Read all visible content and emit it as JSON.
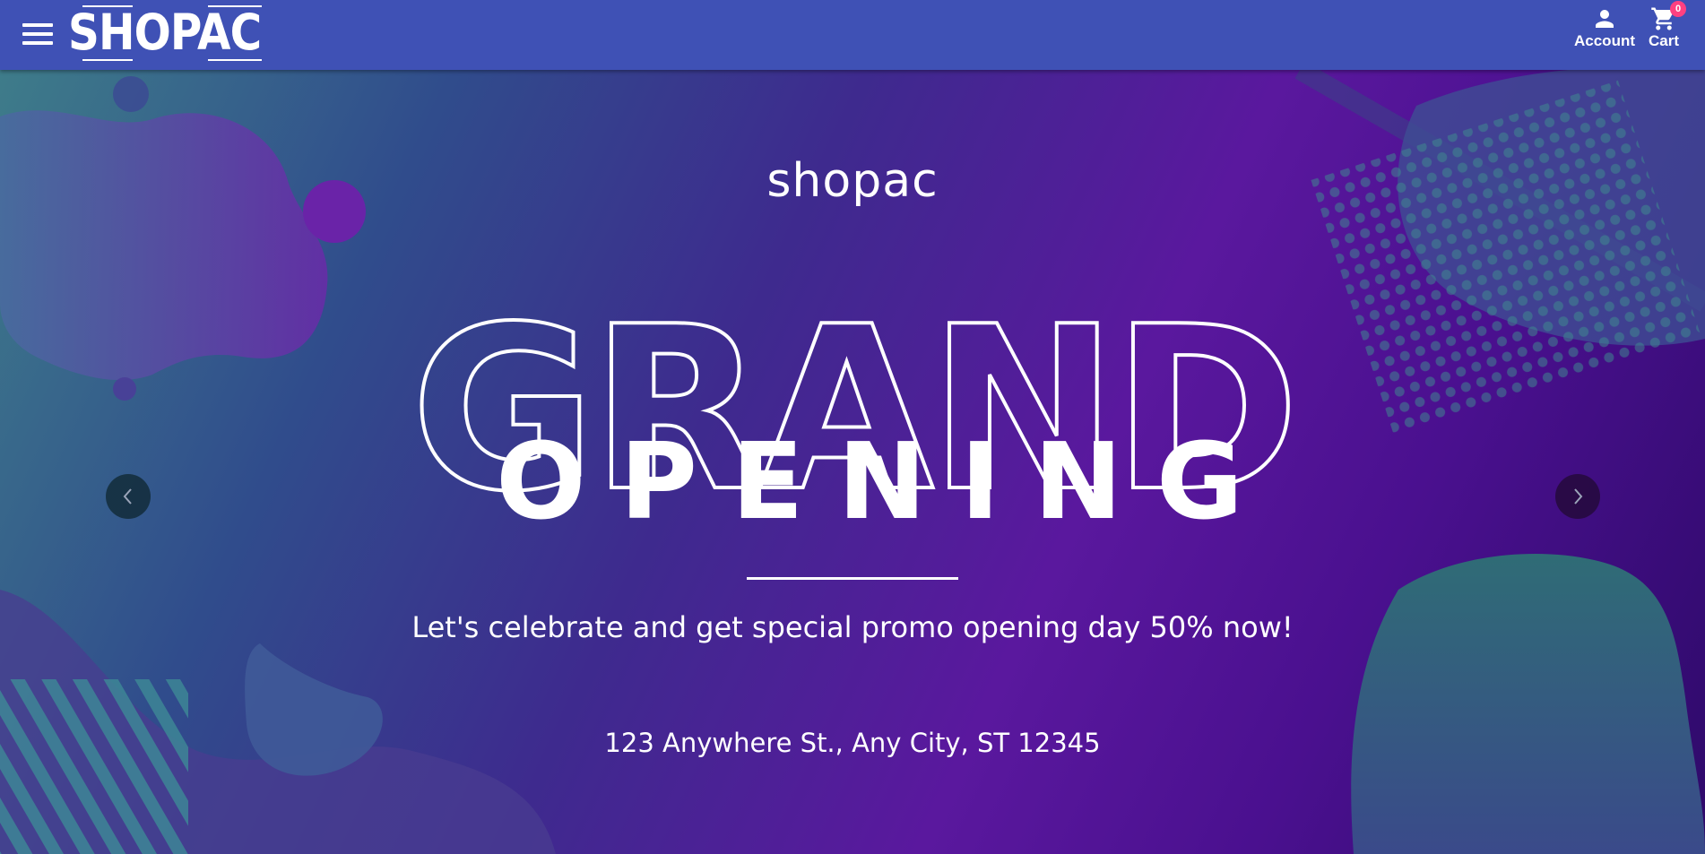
{
  "header": {
    "menu_icon": "hamburger-menu-icon",
    "logo_text": "SHOPAC",
    "account_label": "Account",
    "account_icon": "person-icon",
    "cart_label": "Cart",
    "cart_icon": "shopping-cart-icon",
    "cart_count": "0",
    "background_color": "#3f51b5",
    "badge_color": "#ff4081"
  },
  "carousel": {
    "slide": {
      "brand": "shopac",
      "headline": "GRAND",
      "subheadline": "OPENING",
      "promo_text": "Let's celebrate and get special promo opening day 50% now!",
      "address": "123 Anywhere St., Any City, ST 12345"
    },
    "prev_icon": "chevron-left-icon",
    "next_icon": "chevron-right-icon",
    "colors": {
      "teal": "#3e7c8a",
      "purple": "#5a189e",
      "deep_purple": "#2e0a6a"
    }
  }
}
